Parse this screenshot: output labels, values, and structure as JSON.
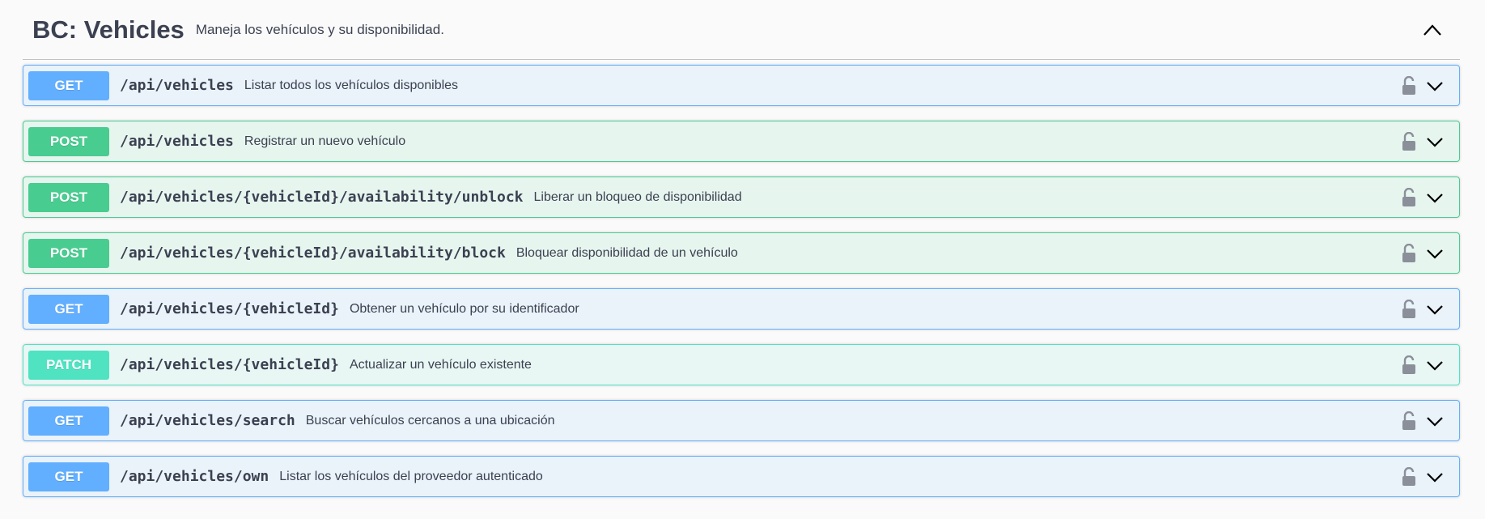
{
  "tag": {
    "title": "BC: Vehicles",
    "description": "Maneja los vehículos y su disponibilidad.",
    "collapse_icon": "chevron-up-icon"
  },
  "operations": [
    {
      "method": "GET",
      "path": "/api/vehicles",
      "summary": "Listar todos los vehículos disponibles"
    },
    {
      "method": "POST",
      "path": "/api/vehicles",
      "summary": "Registrar un nuevo vehículo"
    },
    {
      "method": "POST",
      "path": "/api/vehicles/{vehicleId}/availability/unblock",
      "summary": "Liberar un bloqueo de disponibilidad"
    },
    {
      "method": "POST",
      "path": "/api/vehicles/{vehicleId}/availability/block",
      "summary": "Bloquear disponibilidad de un vehículo"
    },
    {
      "method": "GET",
      "path": "/api/vehicles/{vehicleId}",
      "summary": "Obtener un vehículo por su identificador"
    },
    {
      "method": "PATCH",
      "path": "/api/vehicles/{vehicleId}",
      "summary": "Actualizar un vehículo existente"
    },
    {
      "method": "GET",
      "path": "/api/vehicles/search",
      "summary": "Buscar vehículos cercanos a una ubicación"
    },
    {
      "method": "GET",
      "path": "/api/vehicles/own",
      "summary": "Listar los vehículos del proveedor autenticado"
    }
  ],
  "icons": {
    "lock": "unlocked-padlock-icon",
    "expand": "chevron-down-icon"
  },
  "colors": {
    "get": "#61affe",
    "post": "#49cc90",
    "patch": "#50e3c2",
    "text": "#3b4151"
  }
}
